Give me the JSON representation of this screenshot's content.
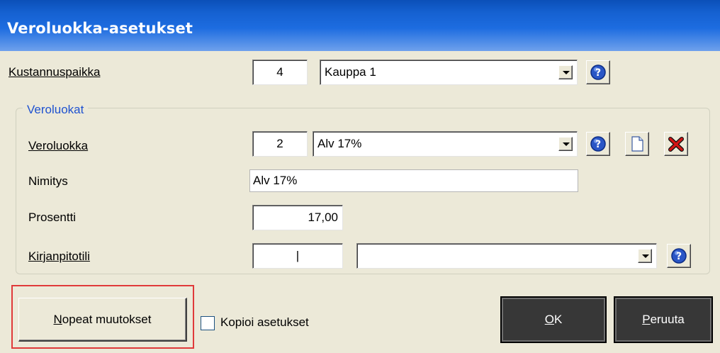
{
  "window": {
    "title": "Veroluokka-asetukset"
  },
  "kustannuspaikka": {
    "label": "Kustannuspaikka",
    "code": "4",
    "selected": "Kauppa 1"
  },
  "group": {
    "legend": "Veroluokat",
    "veroluokka": {
      "label": "Veroluokka",
      "code": "2",
      "selected": "Alv 17%"
    },
    "nimitys": {
      "label": "Nimitys",
      "value": "Alv 17%"
    },
    "prosentti": {
      "label": "Prosentti",
      "value": "17,00"
    },
    "kirjanpitotili": {
      "label": "Kirjanpitotili",
      "code": "|",
      "selected": ""
    }
  },
  "footer": {
    "quick_changes": {
      "first": "N",
      "rest": "opeat muutokset"
    },
    "copy_settings_label": "Kopioi asetukset",
    "copy_settings_checked": false,
    "ok": {
      "first": "O",
      "rest": "K"
    },
    "cancel": {
      "first": "P",
      "rest": "eruuta"
    }
  },
  "colors": {
    "title_bar": "#1d6ce0",
    "legend_text": "#1f52d0",
    "highlight_border": "#e03a3a",
    "dark_button": "#373737"
  },
  "icons": [
    "help-icon",
    "new-document-icon",
    "delete-icon",
    "dropdown-arrow-icon"
  ]
}
